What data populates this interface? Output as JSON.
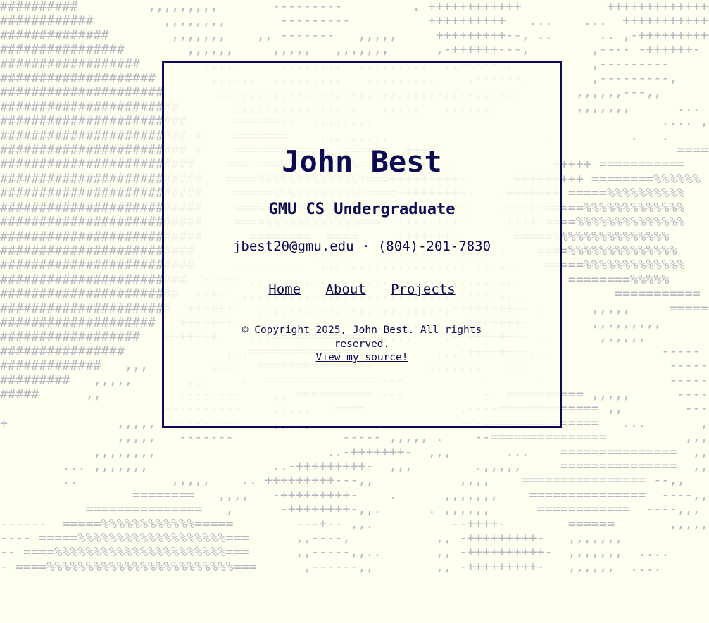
{
  "background": {
    "art": [
      "##########         ,,,,,,,,,       ---------         . ++++++++++++           +++++++++++++++",
      "############         ,,,,,,,,       ---------          ++++++++++   ...    ...  ++++++++++++++",
      "##############        ,,,,,,,    ,, -------   ,,,,,     +++++++++--, ..      .. ,-+++++++++++++",
      "################        ,,,,,,     ,,,,,   ,,,,,,,      ,-++++++---,        ,---- -++++++-",
      "##################        ,,,,,     ,,,,,,,,  ,,,,,,,,,  ,,------,          ,---------",
      "####################       ,,,,,,  ,,,,,,,,,   ,,,,,,,,,    ,------,        ,---------,",
      "#####################       ,,,,,,,,,,,,,,,,,,,,,,,,,,,,,,,,,,,,,,,       ,,,,,,---,,       ,,,,",
      "#######################       ,,,,,,,,,,,,,,,,   ,,,,,   ,,,,,,,          ,,,,,,,      ... ,,,,",
      "########################      ======--  ,,,,,,,,                                     .... ,,,,",
      "######################## +    =======    ,,,,,,,,,                    .          .   .",
      "######################## +    ===========   ======  ++++-                              ======",
      "#########################    === ===%%%%%%%%%%==== +++++--             +++++ ===========",
      "##########################   ====%%%%%%%%%%%%%%===+++++++++-      +++++++++ ========%%%%%%",
      "##########################    =====%%%%%%%%%%%%====+++++++++-   -+++++++ =====%%%%%%%%%%",
      "##########################    ====%%%%%%%%%%%%====-+++++++++-   -+++++=====%%%%%%%%%%%%%",
      "##########################    ====%%%%%%%%%%%%===  ++++++++-     ++++ ====%%%%%%%%%%%%%%",
      "##########################      ========  ====     +++++++-       =====%%%%%%%%%%%%%%%",
      "#########################     -------   ,,,,,   ,,,,,,,,,  ,,,,..    ====%%%%%%%%%%%%%%",
      "#########################     ---------  ,,,,,,,,,,,,,,,,,,, ,,,,,,   =====%%%%%%%%%%%%%",
      "########################  ----- ,,,,,,,,,,,,,,,,,,,,,,,,, ,,,,,,,,,      ========%%%%%",
      "#######################  ++++ ,,,,,,,,,,,,,,,,,,,,,,,,,,,,-+++++,,,,           ===========",
      "######################  ++++++   ,,,,,,,,,,,,,,,,,,,,,,,,,-+++++++-- .      ,,,,,     =====",
      "####################   +++++++   ,,,,,,,,,,,,,,,,,,,,,,,,,,-+++++++-        ,,,,,,,,,",
      "##################   +++++++    ,,,============ ,,,,,    ,-++++++++- ..      ,,,,,,",
      "################             ,,,==============,,,,,,    ,,,-+++++++-...              -----",
      "#############   ,,,        ,,,,  ==============-       .,,,,,,   ...                  ------",
      "#########   ,,,,,       ,,,    .  ===============---          .      .                ------",
      "#####      ,,          --------    ,, ========== ---          -  ========== ,,,,,      ------",
      "                     ----------    ,,,,,   ====            ,----============= ,,        ----",
      "+              ,,,,,  ---------    ,,,,,        ,   .      ---===============   ...       ,,",
      "               ,,,,,   -------              ----- ,,,,, .    --===============          ,,,",
      "            ,,,,,,,,                      ..-+++++++-  ,,,       ...    ===============  ,,",
      "        ... ,,,,,,,                ..-+++++++++-  ,,,        .,,,,,     ===============  ,,",
      "        ..            ,,,,,    .. +++++++++---,,           ,,,,    ================ --,,",
      "                 ========   ,,,,   -+++++++++-    .      ,,,,,,,    ===============  ----,,",
      "           ===============   ,      -++++++++-,,.      . ,,,,,,      ============  ----,,,",
      "------  =====%%%%%%%%%%%%=====        ---+-- ,,.          --++++-        ======       ,,,,,,",
      "---- =====%%%%%%%%%%%%%%%%%%%===      ,,----,           ,, -+++++++++-   ,,,,,,,",
      "-- ====%%%%%%%%%%%%%%%%%%%%%%===      ,,-----,,..       ,, -++++++++++-  ,,,,,,,  ....",
      "- ====%%%%%%%%%%%%%%%%%%%%%%%%===      ,------,,        ,, -+++++++++-   ,,,,,,  ...."
    ]
  },
  "card": {
    "name": "John Best",
    "subtitle": "GMU CS Undergraduate",
    "contact": "jbest20@gmu.edu · (804)-201-7830",
    "nav": {
      "home": "Home",
      "about": "About",
      "projects": "Projects"
    },
    "footer": {
      "copyright": "© Copyright 2025, John Best. All rights reserved.",
      "source_link": "View my source!"
    }
  },
  "colors": {
    "background": "#fffff0",
    "ink": "#0b0b55",
    "ascii_art": "#b7b7c4"
  }
}
